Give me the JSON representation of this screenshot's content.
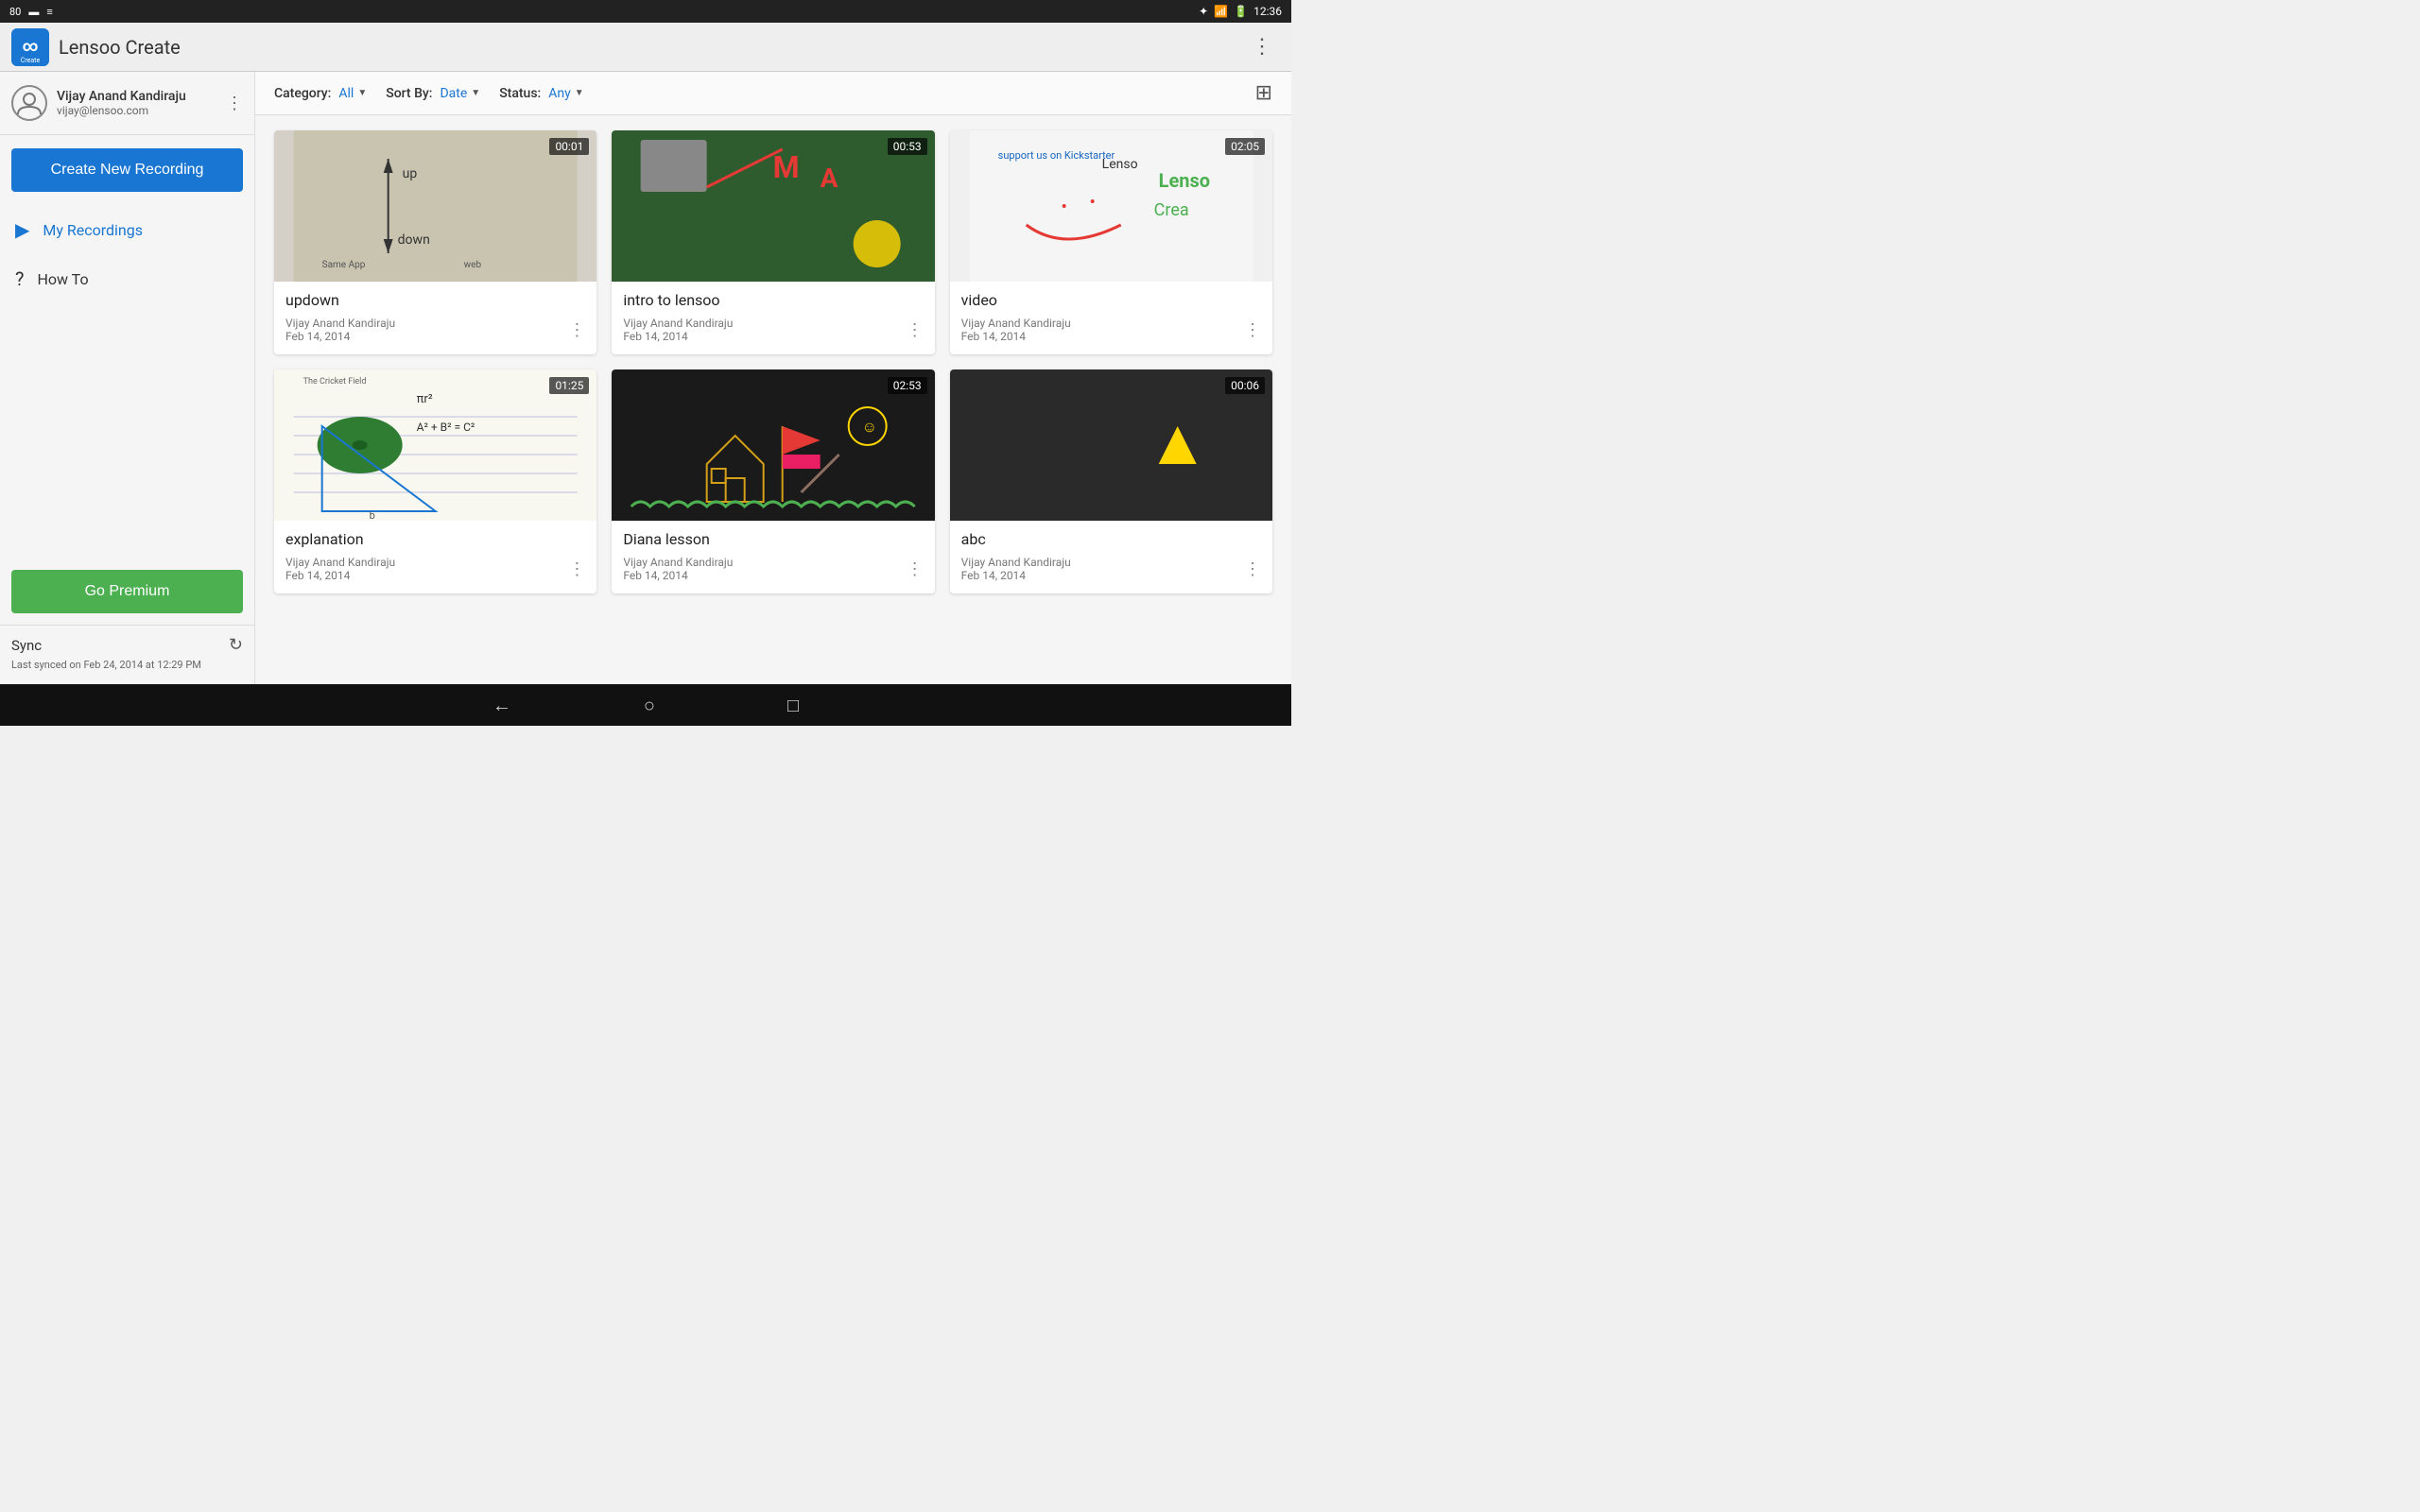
{
  "statusBar": {
    "left": [
      "80",
      "📷",
      "📶"
    ],
    "time": "12:36",
    "icons": [
      "bluetooth",
      "wifi",
      "battery"
    ]
  },
  "appBar": {
    "title": "Lensoo Create",
    "menuIcon": "⋮"
  },
  "sidebar": {
    "user": {
      "name": "Vijay Anand Kandiraju",
      "email": "vijay@lensoo.com"
    },
    "createBtn": "Create New Recording",
    "navItems": [
      {
        "id": "my-recordings",
        "label": "My Recordings",
        "active": true
      },
      {
        "id": "how-to",
        "label": "How To",
        "active": false
      }
    ],
    "premiumBtn": "Go Premium",
    "sync": {
      "label": "Sync",
      "lastSync": "Last synced on Feb 24, 2014 at 12:29 PM"
    }
  },
  "filterBar": {
    "category": {
      "label": "Category:",
      "value": "All"
    },
    "sortBy": {
      "label": "Sort By:",
      "value": "Date"
    },
    "status": {
      "label": "Status:",
      "value": "Any"
    }
  },
  "recordings": [
    {
      "id": 1,
      "title": "updown",
      "author": "Vijay Anand Kandiraju",
      "date": "Feb 14, 2014",
      "duration": "00:01",
      "thumbType": "updown"
    },
    {
      "id": 2,
      "title": "intro to lensoo",
      "author": "Vijay Anand Kandiraju",
      "date": "Feb 14, 2014",
      "duration": "00:53",
      "thumbType": "intro"
    },
    {
      "id": 3,
      "title": "video",
      "author": "Vijay Anand Kandiraju",
      "date": "Feb 14, 2014",
      "duration": "02:05",
      "thumbType": "video"
    },
    {
      "id": 4,
      "title": "explanation",
      "author": "Vijay Anand Kandiraju",
      "date": "Feb 14, 2014",
      "duration": "01:25",
      "thumbType": "explanation"
    },
    {
      "id": 5,
      "title": "Diana lesson",
      "author": "Vijay Anand Kandiraju",
      "date": "Feb 14, 2014",
      "duration": "02:53",
      "thumbType": "diana"
    },
    {
      "id": 6,
      "title": "abc",
      "author": "Vijay Anand Kandiraju",
      "date": "Feb 14, 2014",
      "duration": "00:06",
      "thumbType": "abc"
    }
  ],
  "androidNav": {
    "back": "←",
    "home": "○",
    "recent": "□"
  }
}
